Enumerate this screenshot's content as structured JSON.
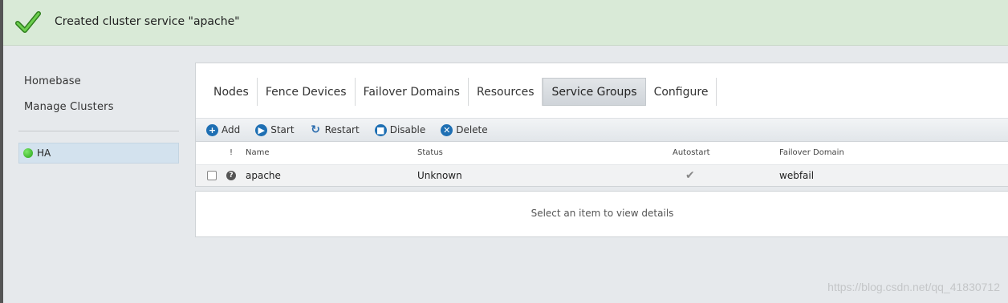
{
  "banner": {
    "message": "Created cluster service \"apache\"",
    "icon": "checkmark-icon",
    "color": "#d9ead7"
  },
  "sidebar": {
    "links": [
      {
        "label": "Homebase"
      },
      {
        "label": "Manage Clusters"
      }
    ],
    "clusters": [
      {
        "label": "HA",
        "status_color": "#27a317"
      }
    ]
  },
  "tabs": [
    {
      "label": "Nodes"
    },
    {
      "label": "Fence Devices"
    },
    {
      "label": "Failover Domains"
    },
    {
      "label": "Resources"
    },
    {
      "label": "Service Groups",
      "active": true
    },
    {
      "label": "Configure"
    }
  ],
  "toolbar": {
    "add": "Add",
    "start": "Start",
    "restart": "Restart",
    "disable": "Disable",
    "delete": "Delete"
  },
  "table": {
    "headers": {
      "alert": "!",
      "name": "Name",
      "status": "Status",
      "autostart": "Autostart",
      "failover": "Failover Domain"
    },
    "rows": [
      {
        "name": "apache",
        "status": "Unknown",
        "autostart": true,
        "failover": "webfail"
      }
    ]
  },
  "details": {
    "message": "Select an item to view details"
  },
  "watermark": "https://blog.csdn.net/qq_41830712"
}
